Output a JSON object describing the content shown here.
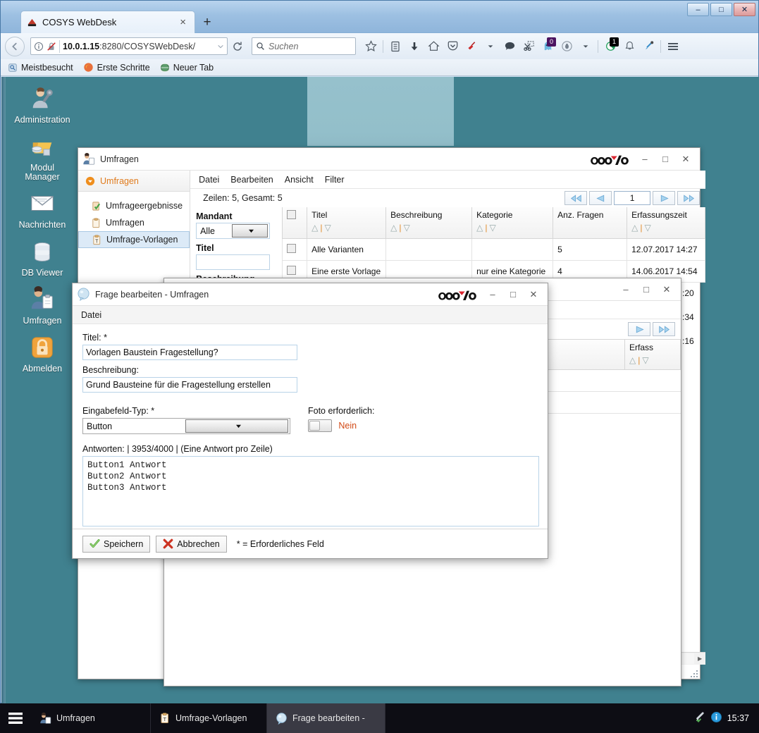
{
  "browser": {
    "tab_title": "COSYS WebDesk",
    "tab_close": "×",
    "new_tab": "+",
    "url_host": "10.0.1.15",
    "url_path": ":8280/COSYSWebDesk/",
    "search_placeholder": "Suchen",
    "reload_label": "⟳",
    "back_label": "←",
    "window_controls": {
      "minimize": "–",
      "maximize": "□",
      "close": "✕"
    },
    "bookmarks": [
      {
        "label": "Meistbesucht",
        "icon": "most-visited-icon"
      },
      {
        "label": "Erste Schritte",
        "icon": "firefox-icon"
      },
      {
        "label": "Neuer Tab",
        "icon": "globe-icon"
      }
    ],
    "toolbar_badges": {
      "ghost_count": "0",
      "shield_count": "1"
    }
  },
  "appnav": {
    "items": [
      {
        "label": "Administration",
        "icon": "admin-user-icon"
      },
      {
        "label": "Modul\nManager",
        "icon": "module-manager-icon"
      },
      {
        "label": "Nachrichten",
        "icon": "envelope-icon"
      },
      {
        "label": "DB Viewer",
        "icon": "database-icon"
      },
      {
        "label": "Umfragen",
        "icon": "survey-clipboard-icon"
      },
      {
        "label": "Abmelden",
        "icon": "lock-icon"
      }
    ]
  },
  "umfragen_window": {
    "title": "Umfragen",
    "brand": "COSYS",
    "controls": {
      "minimize": "–",
      "maximize": "□",
      "close": "✕"
    },
    "menu": [
      "Datei",
      "Bearbeiten",
      "Ansicht",
      "Filter"
    ],
    "tree_root": "Umfragen",
    "tree_items": [
      {
        "label": "Umfrageergebnisse",
        "selected": false
      },
      {
        "label": "Umfragen",
        "selected": false
      },
      {
        "label": "Umfrage-Vorlagen",
        "selected": true
      }
    ],
    "rows_info": "Zeilen: 5, Gesamt: 5",
    "pager": {
      "first": "◀◀",
      "prev": "◀",
      "page": "1",
      "next": "▶",
      "last": "▶▶"
    },
    "filters": [
      {
        "label": "Mandant",
        "type": "select",
        "value": "Alle"
      },
      {
        "label": "Titel",
        "type": "text",
        "value": ""
      },
      {
        "label": "Beschreibung",
        "type": "text",
        "value": ""
      }
    ],
    "table": {
      "columns": [
        "Titel",
        "Beschreibung",
        "Kategorie",
        "Anz. Fragen",
        "Erfassungszeit"
      ],
      "sort_asc": "△",
      "sort_desc": "▽",
      "rows": [
        {
          "titel": "Alle Varianten",
          "beschreibung": "",
          "kategorie": "",
          "anz_fragen": "5",
          "erfassungszeit": "12.07.2017 14:27"
        },
        {
          "titel": "Eine erste Vorlage",
          "beschreibung": "",
          "kategorie": "nur eine Kategorie",
          "anz_fragen": "4",
          "erfassungszeit": "14.06.2017 14:54"
        }
      ]
    },
    "hscroll_thumb_glyph": "|||"
  },
  "vorlagen_window": {
    "controls": {
      "minimize": "–",
      "maximize": "□",
      "close": "✕"
    },
    "pager": {
      "next": "▶",
      "last": "▶▶"
    },
    "column": "Erfass",
    "sort_asc": "△",
    "sort_desc": "▽",
    "partial_times": [
      ":20",
      ":34",
      ":16"
    ]
  },
  "dialog": {
    "title": "Frage bearbeiten - Umfragen",
    "brand": "COSYS",
    "controls": {
      "minimize": "–",
      "maximize": "□",
      "close": "✕"
    },
    "menu": [
      "Datei"
    ],
    "fields": {
      "titel_label": "Titel: *",
      "titel_value": "Vorlagen Baustein Fragestellung?",
      "beschreibung_label": "Beschreibung:",
      "beschreibung_value": "Grund Bausteine für die Fragestellung erstellen",
      "eingabefeld_label": "Eingabefeld-Typ: *",
      "eingabefeld_value": "Button",
      "foto_label": "Foto erforderlich:",
      "foto_value": "Nein",
      "antworten_label": "Antworten: | 3953/4000 | (Eine Antwort pro Zeile)",
      "antworten_value": "Button1 Antwort\nButton2 Antwort\nButton3 Antwort"
    },
    "buttons": {
      "save": "Speichern",
      "cancel": "Abbrechen"
    },
    "required_note": "* = Erforderliches Feld"
  },
  "taskbar": {
    "start_icon": "menu-icon",
    "tasks": [
      {
        "label": "Umfragen",
        "icon": "survey-icon",
        "active": false
      },
      {
        "label": "Umfrage-Vorlagen",
        "icon": "template-icon",
        "active": false
      },
      {
        "label": "Frage bearbeiten -",
        "icon": "question-icon",
        "active": true
      }
    ],
    "tray": {
      "time": "15:37",
      "icons": [
        "pen-icon",
        "info-icon"
      ]
    }
  },
  "colors": {
    "desktop": "#40818f",
    "accent_orange": "#e07b1d",
    "brand_red": "#c0392b",
    "selection_blue": "#dceaf7",
    "warn_red": "#d24a16"
  }
}
